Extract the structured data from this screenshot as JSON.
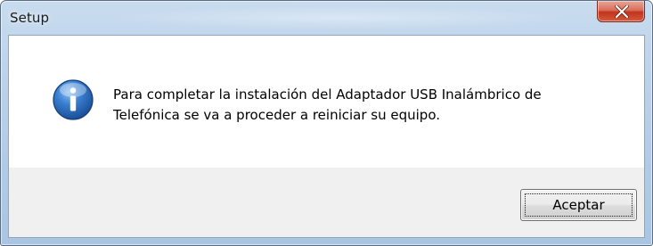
{
  "window": {
    "title": "Setup"
  },
  "titlebar": {
    "close_icon": "close-icon"
  },
  "dialog": {
    "icon": "info-icon",
    "message_lines": [
      "Para completar la instalación del Adaptador USB Inalámbrico de",
      "Telefónica se va a proceder a reiniciar su equipo."
    ],
    "ok_label": "Aceptar"
  },
  "colors": {
    "close_button": "#c2341c",
    "info_icon_blue": "#1f5fae",
    "content_background": "#ffffff",
    "footer_background": "#f0f0f0"
  }
}
